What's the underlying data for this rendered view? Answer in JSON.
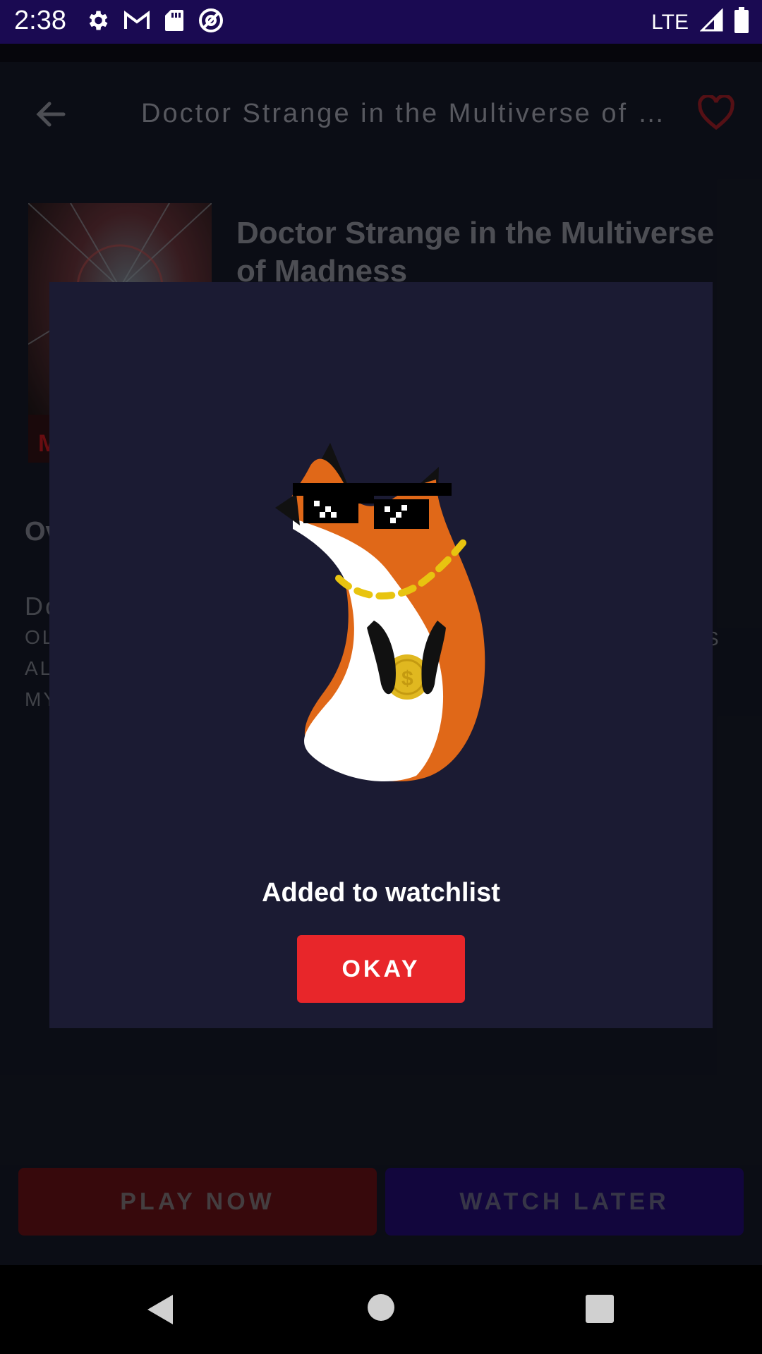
{
  "status_bar": {
    "time": "2:38",
    "network": "LTE",
    "left_icons": [
      "settings-icon",
      "gmail-icon",
      "sd-card-icon",
      "no-sign-icon"
    ],
    "right_icons": [
      "signal-icon",
      "battery-icon"
    ]
  },
  "app_bar": {
    "title": "Doctor Strange in the Multiverse of Madness",
    "back_icon": "arrow-left-icon",
    "favorite_icon": "heart-outline-icon",
    "favorite_color": "#b3202a"
  },
  "movie": {
    "title": "Doctor Strange in the Multiverse of Madness",
    "poster_letter": "M",
    "overview_heading": "Ov",
    "overview_lines": [
      "Do",
      "OL",
      "AL",
      "MY"
    ],
    "overview_trailing_char": "S"
  },
  "actions": {
    "play_label": "PLAY NOW",
    "later_label": "WATCH LATER"
  },
  "dialog": {
    "message": "Added to watchlist",
    "button_label": "OKAY",
    "button_color": "#e8262a",
    "mascot_icon": "fox-mascot-sunglasses"
  },
  "nav_bar": {
    "icons": [
      "nav-back-icon",
      "nav-home-icon",
      "nav-recents-icon"
    ]
  }
}
